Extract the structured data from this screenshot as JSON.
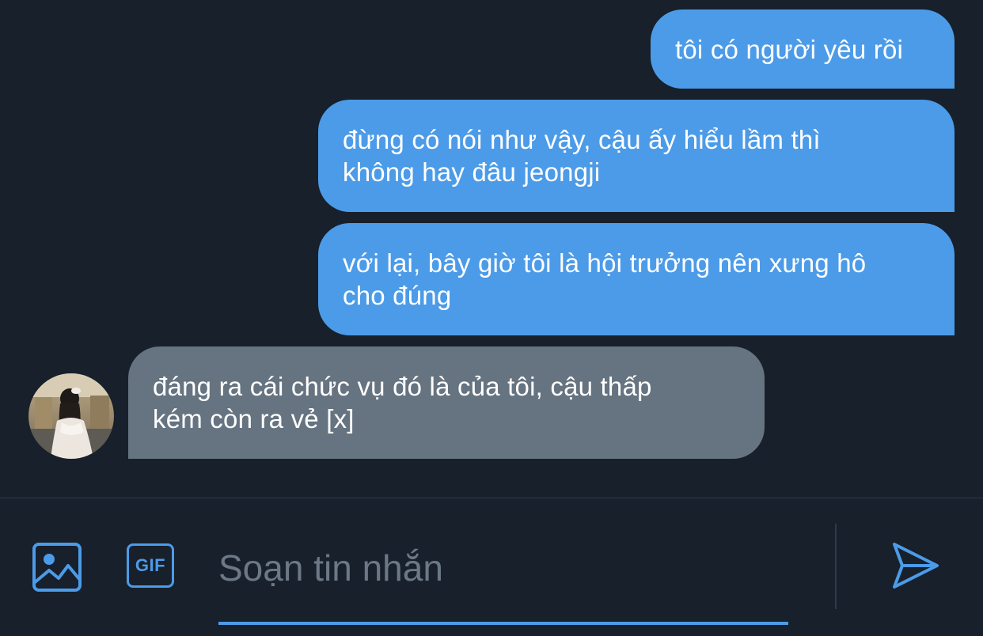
{
  "messages": [
    {
      "direction": "sent",
      "text": "tôi có người yêu rồi"
    },
    {
      "direction": "sent",
      "text": "đừng có nói như vậy, cậu ấy hiểu lầm thì\nkhông hay đâu jeongji"
    },
    {
      "direction": "sent",
      "text": "với lại, bây giờ tôi là hội trưởng nên xưng hô\ncho đúng"
    },
    {
      "direction": "received",
      "text": "đáng ra cái chức vụ đó là của tôi, cậu thấp\nkém còn ra vẻ [x]"
    }
  ],
  "compose": {
    "placeholder": "Soạn tin nhắn",
    "value": "",
    "gif_label": "GIF",
    "image_icon": "image-icon",
    "send_icon": "send-icon"
  },
  "colors": {
    "background": "#17202b",
    "sent_bubble": "#4c9be8",
    "received_bubble": "#667380",
    "accent": "#4c9be8",
    "placeholder": "#6c7886",
    "divider": "#2f3a46"
  }
}
